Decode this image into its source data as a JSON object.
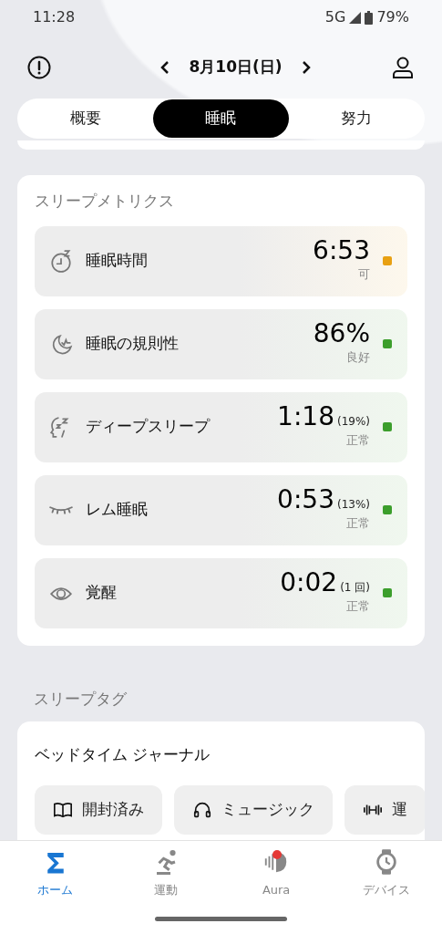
{
  "status_bar": {
    "time": "11:28",
    "network": "5G",
    "battery": "79%"
  },
  "header": {
    "date": "8月10日(日)"
  },
  "tabs": [
    {
      "label": "概要",
      "selected": false
    },
    {
      "label": "睡眠",
      "selected": true
    },
    {
      "label": "努力",
      "selected": false
    }
  ],
  "sleep_metrics": {
    "title": "スリープメトリクス",
    "metrics": [
      {
        "name": "睡眠時間",
        "value": "6:53",
        "rating": "可",
        "color": "#e8a012"
      },
      {
        "name": "睡眠の規則性",
        "value": "86%",
        "rating": "良好",
        "color": "#3c9e2c"
      },
      {
        "name": "ディープスリープ",
        "value": "1:18",
        "detail": "(19%)",
        "rating": "正常",
        "color": "#3c9e2c"
      },
      {
        "name": "レム睡眠",
        "value": "0:53",
        "detail": "(13%)",
        "rating": "正常",
        "color": "#3c9e2c"
      },
      {
        "name": "覚醒",
        "value": "0:02",
        "detail": "(1 回)",
        "rating": "正常",
        "color": "#3c9e2c"
      }
    ]
  },
  "sleep_tags": {
    "title": "スリープタグ",
    "journal_title": "ベッドタイム ジャーナル",
    "chips": [
      {
        "label": "開封済み"
      },
      {
        "label": "ミュージック"
      },
      {
        "label": "運"
      }
    ]
  },
  "bottom_nav": [
    {
      "label": "ホーム",
      "selected": true,
      "notification": false
    },
    {
      "label": "運動",
      "selected": false,
      "notification": false
    },
    {
      "label": "Aura",
      "selected": false,
      "notification": true
    },
    {
      "label": "デバイス",
      "selected": false,
      "notification": false
    }
  ]
}
